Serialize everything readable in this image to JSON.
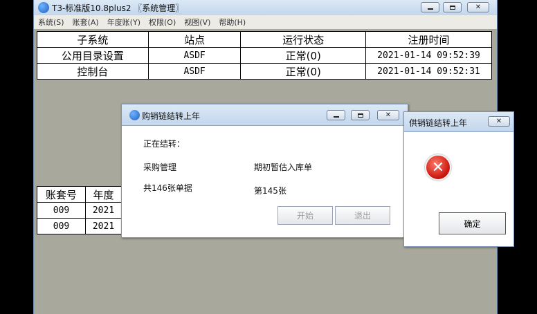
{
  "main_window": {
    "title": "T3-标准版10.8plus2 〖系统管理〗",
    "menu": [
      "系统(S)",
      "账套(A)",
      "年度账(Y)",
      "权限(O)",
      "视图(V)",
      "帮助(H)"
    ]
  },
  "subsystem_table": {
    "headers": [
      "子系统",
      "站点",
      "运行状态",
      "注册时间"
    ],
    "rows": [
      [
        "公用目录设置",
        "ASDF",
        "正常(0)",
        "2021-01-14 09:52:39"
      ],
      [
        "控制台",
        "ASDF",
        "正常(0)",
        "2021-01-14 09:52:31"
      ]
    ]
  },
  "account_table": {
    "headers": [
      "账套号",
      "年度"
    ],
    "rows": [
      [
        "009",
        "2021"
      ],
      [
        "009",
        "2021"
      ]
    ]
  },
  "carryover_dialog": {
    "title": "购销链结转上年",
    "status_label": "正在结转：",
    "module_label": "采购管理",
    "module_value": "期初暂估入库单",
    "total_label": "共146张单据",
    "current_label": "第145张",
    "start_button": "开始",
    "exit_button": "退出"
  },
  "error_dialog": {
    "title": "供销链结转上年",
    "ok_button": "确定"
  },
  "icons": {
    "app": "app-logo-icon",
    "error": "error-icon",
    "minimize": "minimize-icon",
    "maximize": "maximize-icon",
    "close": "close-icon"
  }
}
